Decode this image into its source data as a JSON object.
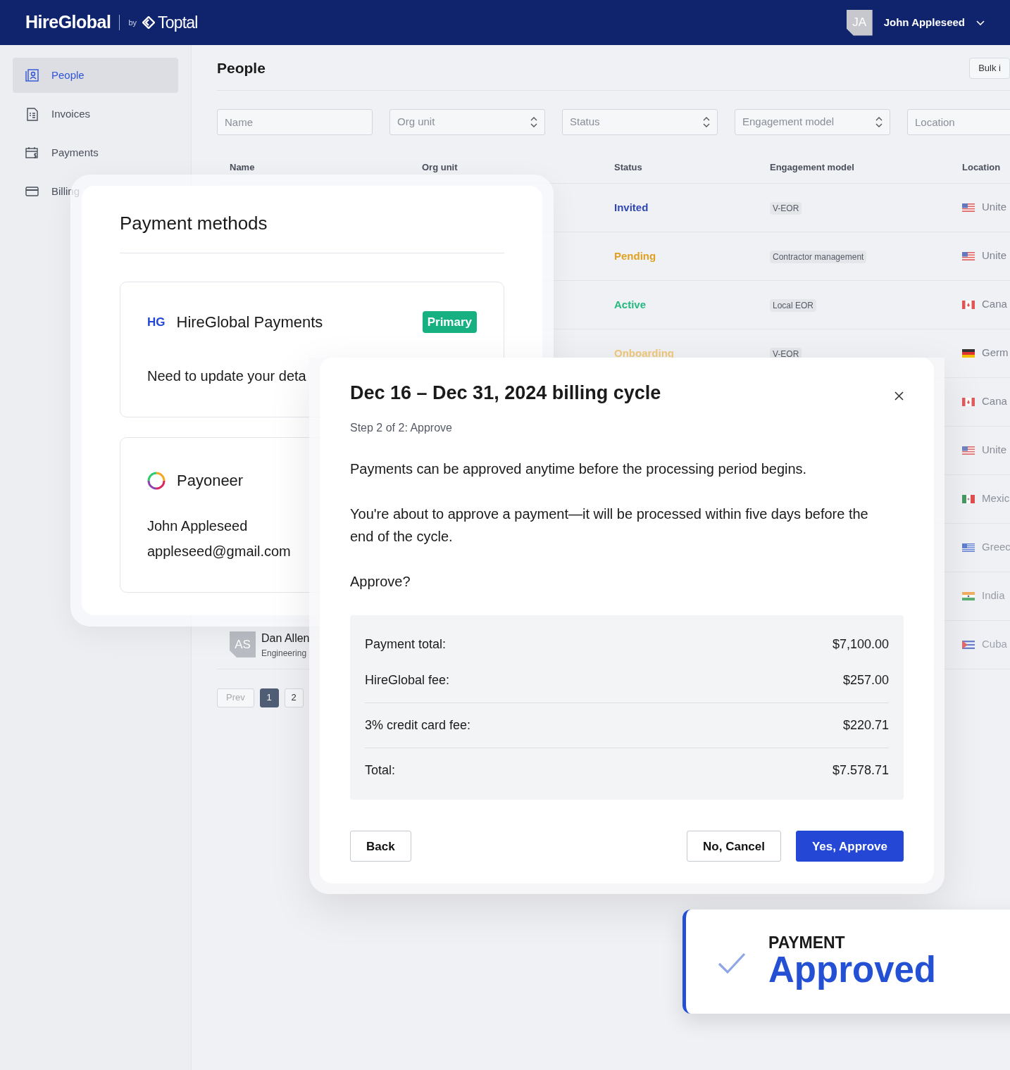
{
  "header": {
    "brand": "HireGlobal",
    "by": "by",
    "partner": "Toptal",
    "user": {
      "initials": "JA",
      "name": "John Appleseed"
    }
  },
  "sidebar": {
    "items": [
      {
        "label": "People",
        "kind": "people",
        "selected": true
      },
      {
        "label": "Invoices",
        "kind": "invoices",
        "selected": false
      },
      {
        "label": "Payments",
        "kind": "payments",
        "selected": false
      },
      {
        "label": "Billing",
        "kind": "billing",
        "selected": false
      }
    ]
  },
  "page": {
    "title": "People",
    "bulk_button": "Bulk i"
  },
  "filters": [
    {
      "placeholder": "Name",
      "kind": "text"
    },
    {
      "placeholder": "Org unit",
      "kind": "select"
    },
    {
      "placeholder": "Status",
      "kind": "select"
    },
    {
      "placeholder": "Engagement model",
      "kind": "select"
    },
    {
      "placeholder": "Location",
      "kind": "text"
    }
  ],
  "table": {
    "columns": [
      "Name",
      "Org unit",
      "Status",
      "Engagement model",
      "Location"
    ],
    "rows": [
      {
        "status": {
          "text": "Invited",
          "color": "#2f47b5"
        },
        "engagement": "V-EOR",
        "location": {
          "kind": "us",
          "text": "Unite"
        }
      },
      {
        "status": {
          "text": "Pending",
          "color": "#e0a020"
        },
        "engagement": "Contractor management",
        "location": {
          "kind": "us",
          "text": "Unite"
        }
      },
      {
        "status": {
          "text": "Active",
          "color": "#25b87f"
        },
        "engagement": "Local EOR",
        "location": {
          "kind": "ca",
          "text": "Cana"
        }
      },
      {
        "status": {
          "text": "Onboarding",
          "color": "#efc87a"
        },
        "engagement": "V-EOR",
        "location": {
          "kind": "de",
          "text": "Germ"
        }
      },
      {
        "location": {
          "kind": "ca",
          "text": "Cana"
        }
      },
      {
        "location": {
          "kind": "us",
          "text": "Unite"
        }
      },
      {
        "location": {
          "kind": "mx",
          "text": "Mexic"
        }
      },
      {
        "location": {
          "kind": "gr",
          "text": "Greec"
        }
      },
      {
        "location": {
          "kind": "in",
          "text": "India"
        }
      },
      {
        "avatar": "AS",
        "name": "Dan Allen",
        "subtitle": "Engineering",
        "location": {
          "kind": "cu",
          "text": "Cuba"
        }
      }
    ]
  },
  "pagination": {
    "prev": "Prev",
    "pages": [
      {
        "label": "1",
        "selected": true
      },
      {
        "label": "2",
        "selected": false
      }
    ]
  },
  "payment_methods": {
    "title": "Payment methods",
    "methods": [
      {
        "kind": "hireglobal",
        "logo": "HG",
        "name": "HireGlobal Payments",
        "badge": "Primary",
        "lines": [
          "Need to update your deta"
        ]
      },
      {
        "kind": "payoneer",
        "name": "Payoneer",
        "lines": [
          "John Appleseed",
          "appleseed@gmail.com"
        ]
      }
    ]
  },
  "modal": {
    "title": "Dec 16 – Dec 31, 2024 billing cycle",
    "step": "Step 2 of 2: Approve",
    "paragraphs": [
      "Payments can be approved anytime before the processing period begins.",
      "You're about to approve a payment—it will be processed within five days before the end of the cycle.",
      "Approve?"
    ],
    "summary": [
      [
        {
          "label": "Payment total:",
          "value": "$7,100.00"
        },
        {
          "label": "HireGlobal fee:",
          "value": "$257.00"
        }
      ],
      [
        {
          "label": "3% credit card fee:",
          "value": "$220.71"
        }
      ],
      [
        {
          "label": "Total:",
          "value": "$7.578.71"
        }
      ]
    ],
    "buttons": [
      {
        "label": "Back",
        "kind": "outline"
      },
      {
        "label": "No, Cancel",
        "kind": "outline"
      },
      {
        "label": "Yes, Approve",
        "kind": "primary"
      }
    ]
  },
  "toast": {
    "eyebrow": "PAYMENT",
    "title": "Approved"
  }
}
